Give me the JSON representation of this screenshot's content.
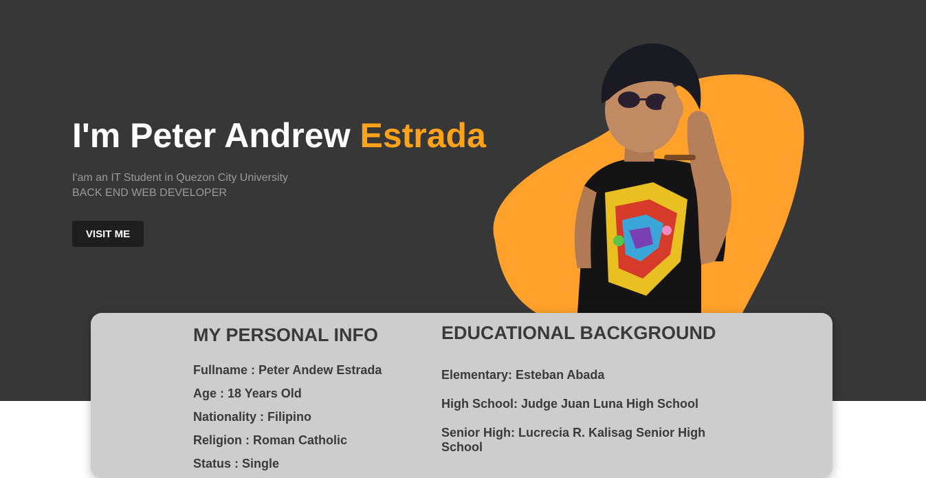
{
  "hero": {
    "title_prefix": "I'm Peter Andrew ",
    "title_accent": "Estrada",
    "subtitle_line1": "I'am an IT Student in Quezon City University",
    "subtitle_line2": "BACK END WEB DEVELOPER",
    "button_label": "VISIT ME",
    "colors": {
      "background": "#373737",
      "accent": "#ffa31a",
      "blob": "#ffa12b",
      "button": "#1e1e1e"
    }
  },
  "personal_info": {
    "heading": "MY PERSONAL INFO",
    "items": [
      "Fullname : Peter Andew Estrada",
      "Age : 18 Years Old",
      "Nationality : Filipino",
      "Religion : Roman Catholic",
      "Status : Single"
    ]
  },
  "education": {
    "heading": "EDUCATIONAL BACKGROUND",
    "items": [
      "Elementary: Esteban Abada",
      "High School: Judge Juan Luna High School",
      "Senior High: Lucrecia R. Kalisag Senior High School"
    ]
  },
  "card": {
    "background": "#cdcdcd"
  }
}
